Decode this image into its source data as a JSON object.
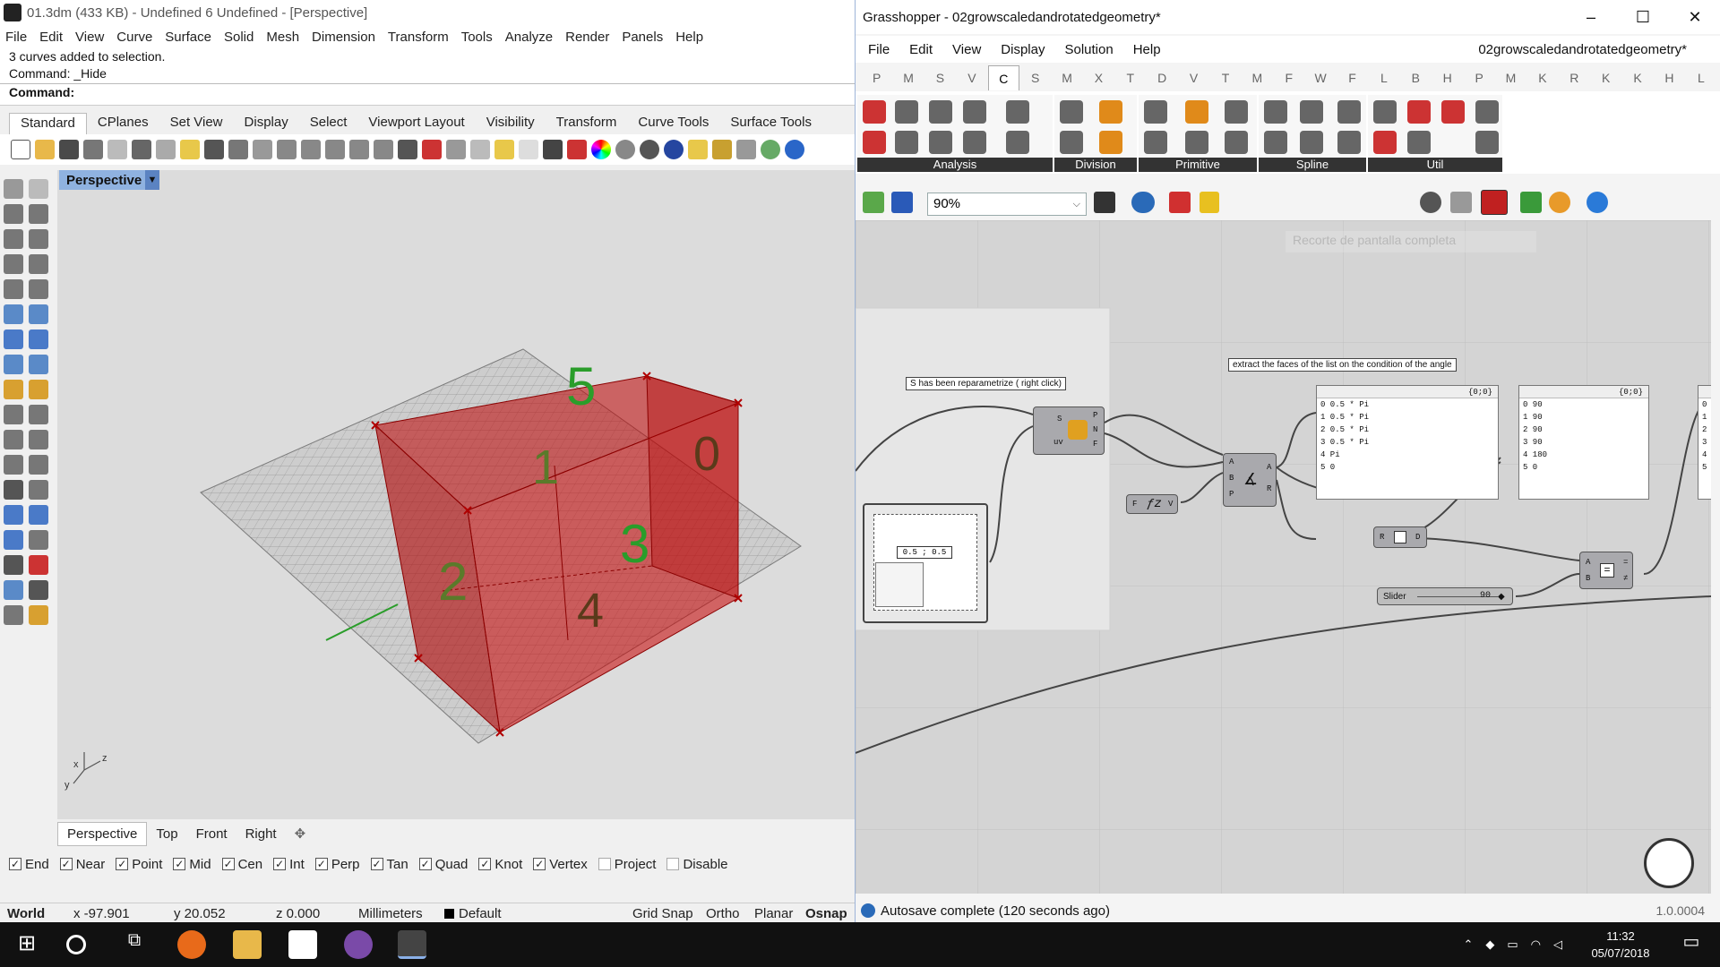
{
  "rhino": {
    "title": "01.3dm (433 KB) - Undefined 6 Undefined - [Perspective]",
    "menu": [
      "File",
      "Edit",
      "View",
      "Curve",
      "Surface",
      "Solid",
      "Mesh",
      "Dimension",
      "Transform",
      "Tools",
      "Analyze",
      "Render",
      "Panels",
      "Help"
    ],
    "command_history": [
      "3 curves added to selection.",
      "Command: _Hide"
    ],
    "command_prompt": "Command:",
    "toolbar_tabs": [
      "Standard",
      "CPlanes",
      "Set View",
      "Display",
      "Select",
      "Viewport Layout",
      "Visibility",
      "Transform",
      "Curve Tools",
      "Surface Tools"
    ],
    "active_toolbar_tab": "Standard",
    "viewport_name": "Perspective",
    "viewport_tabs": [
      "Perspective",
      "Top",
      "Front",
      "Right"
    ],
    "active_viewport_tab": "Perspective",
    "face_labels": [
      "5",
      "1",
      "0",
      "2",
      "3",
      "4"
    ],
    "axis_labels": {
      "x": "x",
      "y": "y",
      "z": "z"
    },
    "osnaps": [
      {
        "label": "End",
        "checked": true
      },
      {
        "label": "Near",
        "checked": true
      },
      {
        "label": "Point",
        "checked": true
      },
      {
        "label": "Mid",
        "checked": true
      },
      {
        "label": "Cen",
        "checked": true
      },
      {
        "label": "Int",
        "checked": true
      },
      {
        "label": "Perp",
        "checked": true
      },
      {
        "label": "Tan",
        "checked": true
      },
      {
        "label": "Quad",
        "checked": true
      },
      {
        "label": "Knot",
        "checked": true
      },
      {
        "label": "Vertex",
        "checked": true
      },
      {
        "label": "Project",
        "checked": false
      },
      {
        "label": "Disable",
        "checked": false
      }
    ],
    "status": {
      "cplane": "World",
      "x": "x -97.901",
      "y": "y 20.052",
      "z": "z 0.000",
      "units": "Millimeters",
      "layer": "Default",
      "grid_snap": "Grid Snap",
      "ortho": "Ortho",
      "planar": "Planar",
      "osnap": "Osnap"
    },
    "colors": {
      "box": "#c00000",
      "labels": "#2a9d2a",
      "grid": "#7a7a7a"
    }
  },
  "grasshopper": {
    "title": "Grasshopper - 02growscaledandrotatedgeometry*",
    "menu": [
      "File",
      "Edit",
      "View",
      "Display",
      "Solution",
      "Help"
    ],
    "document_name": "02growscaledandrotatedgeometry*",
    "categories": [
      "P",
      "M",
      "S",
      "V",
      "C",
      "S",
      "M",
      "X",
      "T",
      "D",
      "V",
      "T",
      "M",
      "F",
      "W",
      "F",
      "L",
      "B",
      "H",
      "P",
      "M",
      "K",
      "R",
      "K",
      "K",
      "H",
      "L"
    ],
    "active_category": "C",
    "ribbon_groups": [
      "Analysis",
      "Division",
      "Primitive",
      "Spline",
      "Util"
    ],
    "zoom": "90%",
    "ghost_text": "Recorte de pantalla completa",
    "labels": {
      "reparam": "S has been reparametrize ( right click)",
      "extract": "extract the faces of the list on the condition of the angle"
    },
    "panel1": {
      "path": "{0;0}",
      "rows": [
        "0  0.5 * Pi",
        "1  0.5 * Pi",
        "2  0.5 * Pi",
        "3  0.5 * Pi",
        "4  Pi",
        "5  0"
      ]
    },
    "panel2": {
      "path": "{0;0}",
      "rows": [
        "0  90",
        "1  90",
        "2  90",
        "3  90",
        "4  180",
        "5  0"
      ]
    },
    "panel3": {
      "rows": [
        "0",
        "1",
        "2",
        "3",
        "4",
        "5"
      ]
    },
    "md_slider_value": "0.5 ; 0.5",
    "slider": {
      "label": "Slider",
      "value": "90"
    },
    "node_eval": {
      "inputs": [
        "S",
        "uv"
      ],
      "outputs": [
        "P",
        "N",
        "F"
      ]
    },
    "node_angle": {
      "inputs": [
        "A",
        "B",
        "P"
      ],
      "outputs": [
        "A",
        "R"
      ]
    },
    "node_expr": {
      "inputs": [
        "F"
      ],
      "outputs": [
        "V"
      ]
    },
    "node_rad": {
      "inputs": [
        "R"
      ],
      "outputs": [
        "D"
      ]
    },
    "node_eq": {
      "inputs": [
        "A",
        "B"
      ],
      "outputs": [
        "=",
        "≠"
      ]
    },
    "status": "Autosave complete (120 seconds ago)",
    "version": "1.0.0004"
  },
  "taskbar": {
    "time": "11:32",
    "date": "05/07/2018"
  }
}
